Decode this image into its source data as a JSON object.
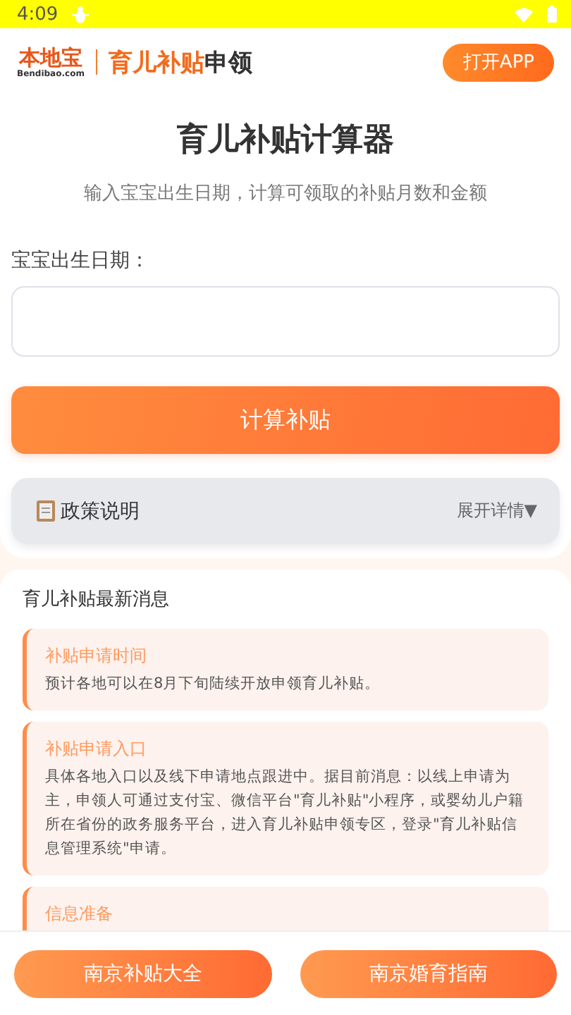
{
  "status_bar": {
    "time": "4:09"
  },
  "header": {
    "logo": {
      "name": "本地宝",
      "domain": "Bendibao.com"
    },
    "title_accent": "育儿补贴",
    "title_rest": "申领",
    "open_app": "打开APP"
  },
  "calculator": {
    "title": "育儿补贴计算器",
    "subtitle": "输入宝宝出生日期，计算可领取的补贴月数和金额",
    "field_label": "宝宝出生日期：",
    "submit": "计算补贴",
    "policy": {
      "label": "政策说明",
      "toggle": "展开详情▼",
      "expanded": false
    }
  },
  "news": {
    "title": "育儿补贴最新消息",
    "items": [
      {
        "title": "补贴申请时间",
        "body": "预计各地可以在8月下旬陆续开放申领育儿补贴。"
      },
      {
        "title": "补贴申请入口",
        "body": "具体各地入口以及线下申请地点跟进中。据目前消息：以线上申请为主，申领人可通过支付宝、微信平台\"育儿补贴\"小程序，或婴幼儿户籍所在省份的政务服务平台，进入育儿补贴申领专区，登录\"育儿补贴信息管理系统\"申请。"
      },
      {
        "title": "信息准备"
      }
    ]
  },
  "bottom_buttons": [
    "南京补贴大全",
    "南京婚育指南"
  ]
}
